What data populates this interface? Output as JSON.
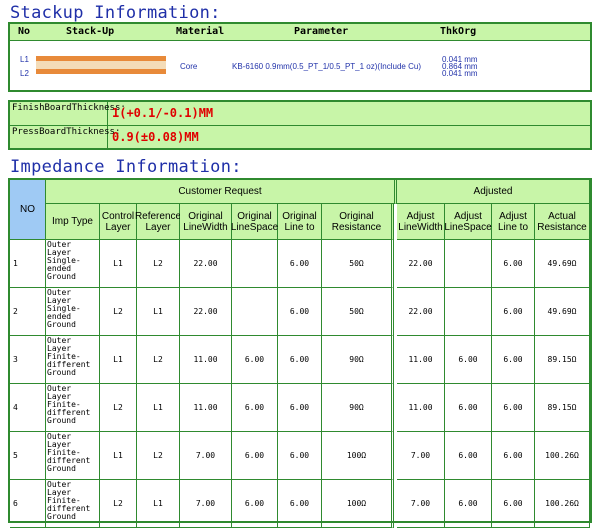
{
  "stackup": {
    "title": "Stackup Information:",
    "headers": [
      "No",
      "Stack-Up",
      "Material",
      "Parameter",
      "ThkOrg"
    ],
    "layers": [
      "L1",
      "L2"
    ],
    "material": "Core",
    "parameter": "KB-6160 0.9mm(0.5_PT_1/0.5_PT_1 oz)(Include Cu)",
    "thk": [
      "0.041 mm",
      "0.864 mm",
      "0.041 mm"
    ]
  },
  "thickness": {
    "finish_label": "FinishBoardThickness:",
    "finish_value": "1(+0.1/-0.1)MM",
    "press_label": "PressBoardThickness:",
    "press_value": "0.9(±0.08)MM"
  },
  "impedance": {
    "title": "Impedance Information:",
    "no_header": "NO",
    "group_customer": "Customer Request",
    "group_adjusted": "Adjusted",
    "columns": [
      "Imp Type",
      "Control Layer",
      "Reference Layer",
      "Original LineWidth",
      "Original LineSpace",
      "Original Line to",
      "Original Resistance",
      "Adjust LineWidth",
      "Adjust LineSpace",
      "Adjust Line to",
      "Actual Resistance"
    ],
    "rows": [
      {
        "no": "1",
        "type": "Outer Layer Single-ended Ground",
        "ctrl": "L1",
        "ref": "L2",
        "ow": "22.00",
        "os": "",
        "ol": "6.00",
        "ores": "50Ω",
        "aw": "22.00",
        "as": "",
        "al": "6.00",
        "ares": "49.69Ω"
      },
      {
        "no": "2",
        "type": "Outer Layer Single-ended Ground",
        "ctrl": "L2",
        "ref": "L1",
        "ow": "22.00",
        "os": "",
        "ol": "6.00",
        "ores": "50Ω",
        "aw": "22.00",
        "as": "",
        "al": "6.00",
        "ares": "49.69Ω"
      },
      {
        "no": "3",
        "type": "Outer Layer Finite-different Ground",
        "ctrl": "L1",
        "ref": "L2",
        "ow": "11.00",
        "os": "6.00",
        "ol": "6.00",
        "ores": "90Ω",
        "aw": "11.00",
        "as": "6.00",
        "al": "6.00",
        "ares": "89.15Ω"
      },
      {
        "no": "4",
        "type": "Outer Layer Finite-different Ground",
        "ctrl": "L2",
        "ref": "L1",
        "ow": "11.00",
        "os": "6.00",
        "ol": "6.00",
        "ores": "90Ω",
        "aw": "11.00",
        "as": "6.00",
        "al": "6.00",
        "ares": "89.15Ω"
      },
      {
        "no": "5",
        "type": "Outer Layer Finite-different Ground",
        "ctrl": "L1",
        "ref": "L2",
        "ow": "7.00",
        "os": "6.00",
        "ol": "6.00",
        "ores": "100Ω",
        "aw": "7.00",
        "as": "6.00",
        "al": "6.00",
        "ares": "100.26Ω"
      },
      {
        "no": "6",
        "type": "Outer Layer Finite-different Ground",
        "ctrl": "L2",
        "ref": "L1",
        "ow": "7.00",
        "os": "6.00",
        "ol": "6.00",
        "ores": "100Ω",
        "aw": "7.00",
        "as": "6.00",
        "al": "6.00",
        "ares": "100.26Ω"
      }
    ]
  },
  "colors": {
    "header_green": "#c8f5a8",
    "border_green": "#2f8a2f",
    "title_blue": "#1f2fa8",
    "no_blue": "#9fcaf4",
    "value_red": "#e00000",
    "copper": "#e88a3a"
  }
}
